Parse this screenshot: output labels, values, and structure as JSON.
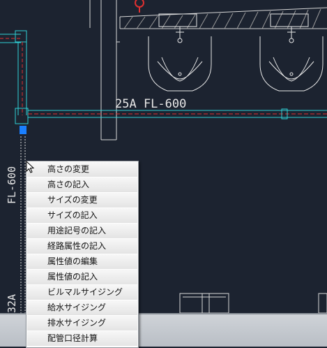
{
  "drawing": {
    "horizontal_pipe_label": "25A FL-600",
    "vertical_pipe_label": "FL-600",
    "vertical_pipe_label_partial": "32A"
  },
  "context_menu": {
    "items": [
      {
        "name": "menu-item-height-change",
        "label": "高さの変更"
      },
      {
        "name": "menu-item-height-note",
        "label": "高さの記入"
      },
      {
        "name": "menu-item-size-change",
        "label": "サイズの変更"
      },
      {
        "name": "menu-item-size-note",
        "label": "サイズの記入"
      },
      {
        "name": "menu-item-usage-code-note",
        "label": "用途記号の記入"
      },
      {
        "name": "menu-item-route-attr-note",
        "label": "経路属性の記入"
      },
      {
        "name": "menu-item-attr-edit",
        "label": "属性値の編集"
      },
      {
        "name": "menu-item-attr-note",
        "label": "属性値の記入"
      },
      {
        "name": "menu-item-building-sizing",
        "label": "ビルマルサイジング"
      },
      {
        "name": "menu-item-supply-sizing",
        "label": "給水サイジング"
      },
      {
        "name": "menu-item-drain-sizing",
        "label": "排水サイジング"
      },
      {
        "name": "menu-item-pipe-diameter-calc",
        "label": "配管口径計算"
      }
    ]
  },
  "colors": {
    "background": "#1c2330",
    "pipe_cyan": "#2fd0d6",
    "pipe_red": "#e03030",
    "fixture_white": "#e8e8e8",
    "fitting_blue": "#1a7fff"
  }
}
